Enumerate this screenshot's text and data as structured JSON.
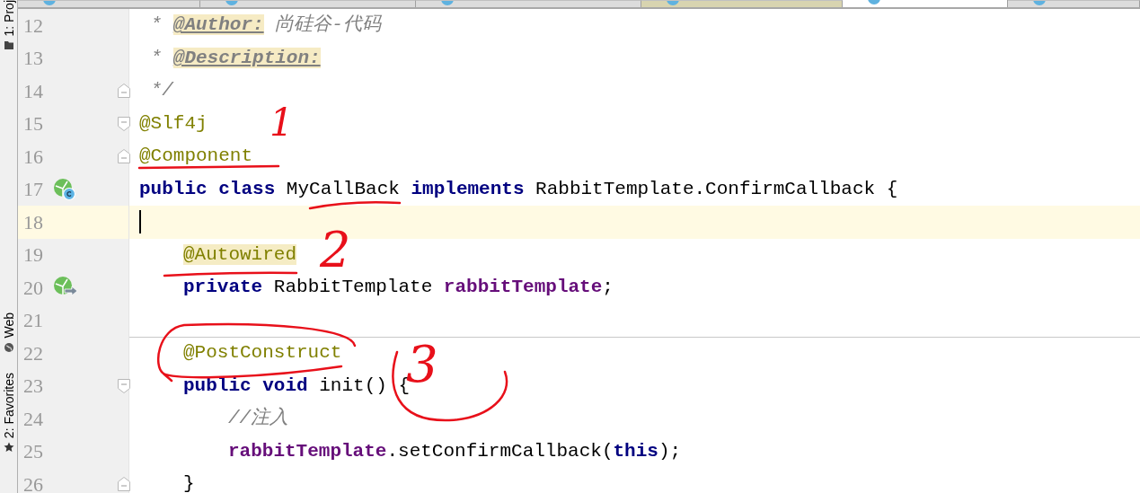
{
  "editor_tabs": [
    {
      "selected": false,
      "color": "#dcdcdc"
    },
    {
      "selected": false,
      "color": "#dcdcdc"
    },
    {
      "selected": false,
      "color": "#dcdcdc"
    },
    {
      "selected": false,
      "color": "#d8d4b0"
    },
    {
      "selected": true,
      "color": "#ffffff"
    },
    {
      "selected": false,
      "color": "#dcdcdc"
    }
  ],
  "tool_strip": [
    {
      "label": "1: Proj"
    },
    {
      "label": "Web"
    },
    {
      "label": "2: Favorites"
    }
  ],
  "lines": [
    {
      "number": "12",
      "kind": "top",
      "tokens": [
        {
          "kind": "comment",
          "text": " * "
        },
        {
          "kind": "doctag",
          "text": "@Author:"
        },
        {
          "kind": "comment",
          "text": " 尚硅谷-代码"
        }
      ]
    },
    {
      "number": "13",
      "kind": "top",
      "tokens": [
        {
          "kind": "comment",
          "text": " * "
        },
        {
          "kind": "doctag",
          "text": "@Description:"
        }
      ]
    },
    {
      "number": "14",
      "kind": "top",
      "fold_end": true,
      "tokens": [
        {
          "kind": "comment",
          "text": " */"
        }
      ]
    },
    {
      "number": "15",
      "kind": "top",
      "fold_start": true,
      "tokens": [
        {
          "kind": "annotation",
          "text": "@Slf4j"
        }
      ]
    },
    {
      "number": "16",
      "kind": "top",
      "fold_end": true,
      "tokens": [
        {
          "kind": "annotation",
          "text": "@Component"
        }
      ]
    },
    {
      "number": "17",
      "kind": "top",
      "class_marker": true,
      "tokens": [
        {
          "kind": "keyword",
          "text": "public "
        },
        {
          "kind": "keyword",
          "text": "class "
        },
        {
          "kind": "plain",
          "text": "MyCallBack "
        },
        {
          "kind": "keyword",
          "text": "implements "
        },
        {
          "kind": "plain",
          "text": "RabbitTemplate.ConfirmCallback {"
        }
      ]
    },
    {
      "number": "18",
      "kind": "top",
      "current": true
    },
    {
      "number": "19",
      "kind": "member",
      "tokens": [
        {
          "kind": "annotation_marked",
          "text": "@Autowired"
        }
      ]
    },
    {
      "number": "20",
      "kind": "member",
      "injection_marker": true,
      "tokens": [
        {
          "kind": "keyword",
          "text": "private "
        },
        {
          "kind": "plain",
          "text": "RabbitTemplate "
        },
        {
          "kind": "field",
          "text": "rabbitTemplate"
        },
        {
          "kind": "plain",
          "text": ";"
        }
      ]
    },
    {
      "number": "21",
      "kind": "top"
    },
    {
      "number": "22",
      "kind": "member",
      "separator": true,
      "tokens": [
        {
          "kind": "annotation",
          "text": "@PostConstruct"
        }
      ]
    },
    {
      "number": "23",
      "kind": "member",
      "fold_start": true,
      "tokens": [
        {
          "kind": "keyword",
          "text": "public "
        },
        {
          "kind": "keyword",
          "text": "void "
        },
        {
          "kind": "plain",
          "text": "init() {"
        }
      ]
    },
    {
      "number": "24",
      "kind": "statement",
      "tokens": [
        {
          "kind": "comment",
          "text": "//注入"
        }
      ]
    },
    {
      "number": "25",
      "kind": "statement",
      "tokens": [
        {
          "kind": "field",
          "text": "rabbitTemplate"
        },
        {
          "kind": "plain",
          "text": ".setConfirmCallback("
        },
        {
          "kind": "keyword",
          "text": "this"
        },
        {
          "kind": "plain",
          "text": ");"
        }
      ]
    },
    {
      "number": "26",
      "kind": "member",
      "fold_end": true,
      "tokens": [
        {
          "kind": "plain",
          "text": "}"
        }
      ]
    }
  ],
  "handwritten_numbers": [
    "1",
    "2",
    "3"
  ]
}
